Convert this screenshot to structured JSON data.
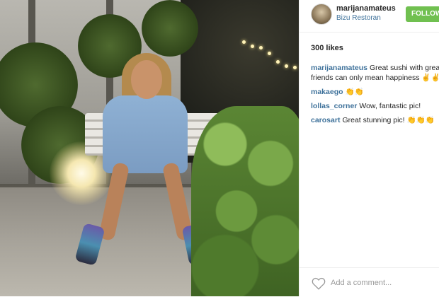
{
  "post": {
    "username": "marijanamateus",
    "location": "Bizu Restoran",
    "follow_label": "FOLLOW",
    "likes": "300 likes",
    "comments": [
      {
        "user": "marijanamateus",
        "text": "Great sushi with great friends can only mean happiness ✌️✌️"
      },
      {
        "user": "makaego",
        "text": "👏👏"
      },
      {
        "user": "lollas_corner",
        "text": "Wow, fantastic pic!"
      },
      {
        "user": "carosart",
        "text": "Great stunning pic! 👏👏👏"
      }
    ],
    "add_comment_placeholder": "Add a comment..."
  },
  "colors": {
    "follow_button": "#70c050",
    "username_link": "#3f729b"
  },
  "icons": {
    "like": "heart-icon"
  }
}
